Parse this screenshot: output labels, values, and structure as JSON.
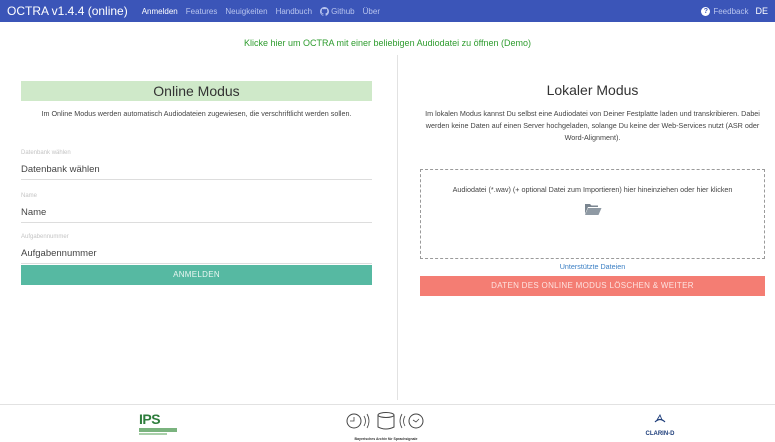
{
  "navbar": {
    "brand": "OCTRA v1.4.4 (online)",
    "items": [
      {
        "label": "Anmelden",
        "active": true
      },
      {
        "label": "Features",
        "active": false
      },
      {
        "label": "Neuigkeiten",
        "active": false
      },
      {
        "label": "Handbuch",
        "active": false
      },
      {
        "label": "Github",
        "active": false,
        "icon": "github-icon"
      },
      {
        "label": "Über",
        "active": false
      }
    ],
    "feedback": {
      "label": "Feedback",
      "icon": "question-circle-icon"
    },
    "language": "DE",
    "background": "#3b55b8"
  },
  "demo_link": "Klicke hier um OCTRA mit einer beliebigen Audiodatei zu öffnen (Demo)",
  "online": {
    "title": "Online Modus",
    "description": "Im Online Modus werden automatisch Audiodateien zugewiesen, die verschriftlicht werden sollen.",
    "fields": [
      {
        "label": "Datenbank wählen",
        "value": "Datenbank wählen"
      },
      {
        "label": "Name",
        "value": "Name"
      },
      {
        "label": "Aufgabennummer",
        "value": "Aufgabennummer"
      }
    ],
    "login_button": "ANMELDEN",
    "button_color": "#56b9a2"
  },
  "local": {
    "title": "Lokaler Modus",
    "description": "Im lokalen Modus kannst Du selbst eine Audiodatei von Deiner Festplatte laden und transkribieren. Dabei werden keine Daten auf einen Server hochgeladen, solange Du keine der Web-Services nutzt (ASR oder Word-Alignment).",
    "dropzone_text": "Audiodatei (*.wav) (+ optional Datei zum Importieren) hier hineinziehen oder hier klicken",
    "dropzone_icon": "folder-open-icon",
    "supported_files": "Unterstützte Dateien",
    "delete_button": "DATEN DES ONLINE MODUS LÖSCHEN & WEITER",
    "button_color": "#f47d73"
  },
  "footer": {
    "ips_logo": "IPS",
    "bas_caption": "Bayerisches Archiv für Sprachsignale",
    "clarin_logo": "CLARIN-D"
  }
}
